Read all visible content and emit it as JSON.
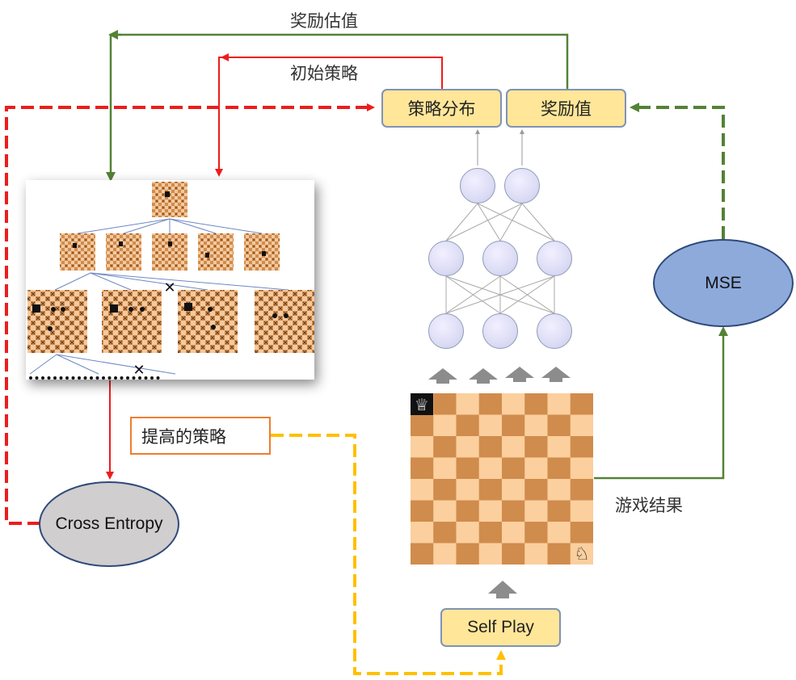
{
  "labels": {
    "reward_estimate": "奖励估值",
    "initial_policy": "初始策略",
    "policy_distribution": "策略分布",
    "reward_value": "奖励值",
    "improved_policy": "提高的策略",
    "game_result": "游戏结果",
    "mse": "MSE",
    "cross_entropy": "Cross Entropy",
    "self_play": "Self Play"
  },
  "colors": {
    "red_arrow": "#ee1c1c",
    "green_arrow": "#548235",
    "orange_dashed": "#ffc000",
    "box_fill": "#ffe699",
    "mse_fill": "#8eaadb",
    "cross_entropy_fill": "#d0cece",
    "board_dark": "#d08c4c",
    "board_light": "#fbcf9e"
  },
  "board": {
    "pieces": [
      "queen-piece",
      "knight-piece"
    ]
  }
}
